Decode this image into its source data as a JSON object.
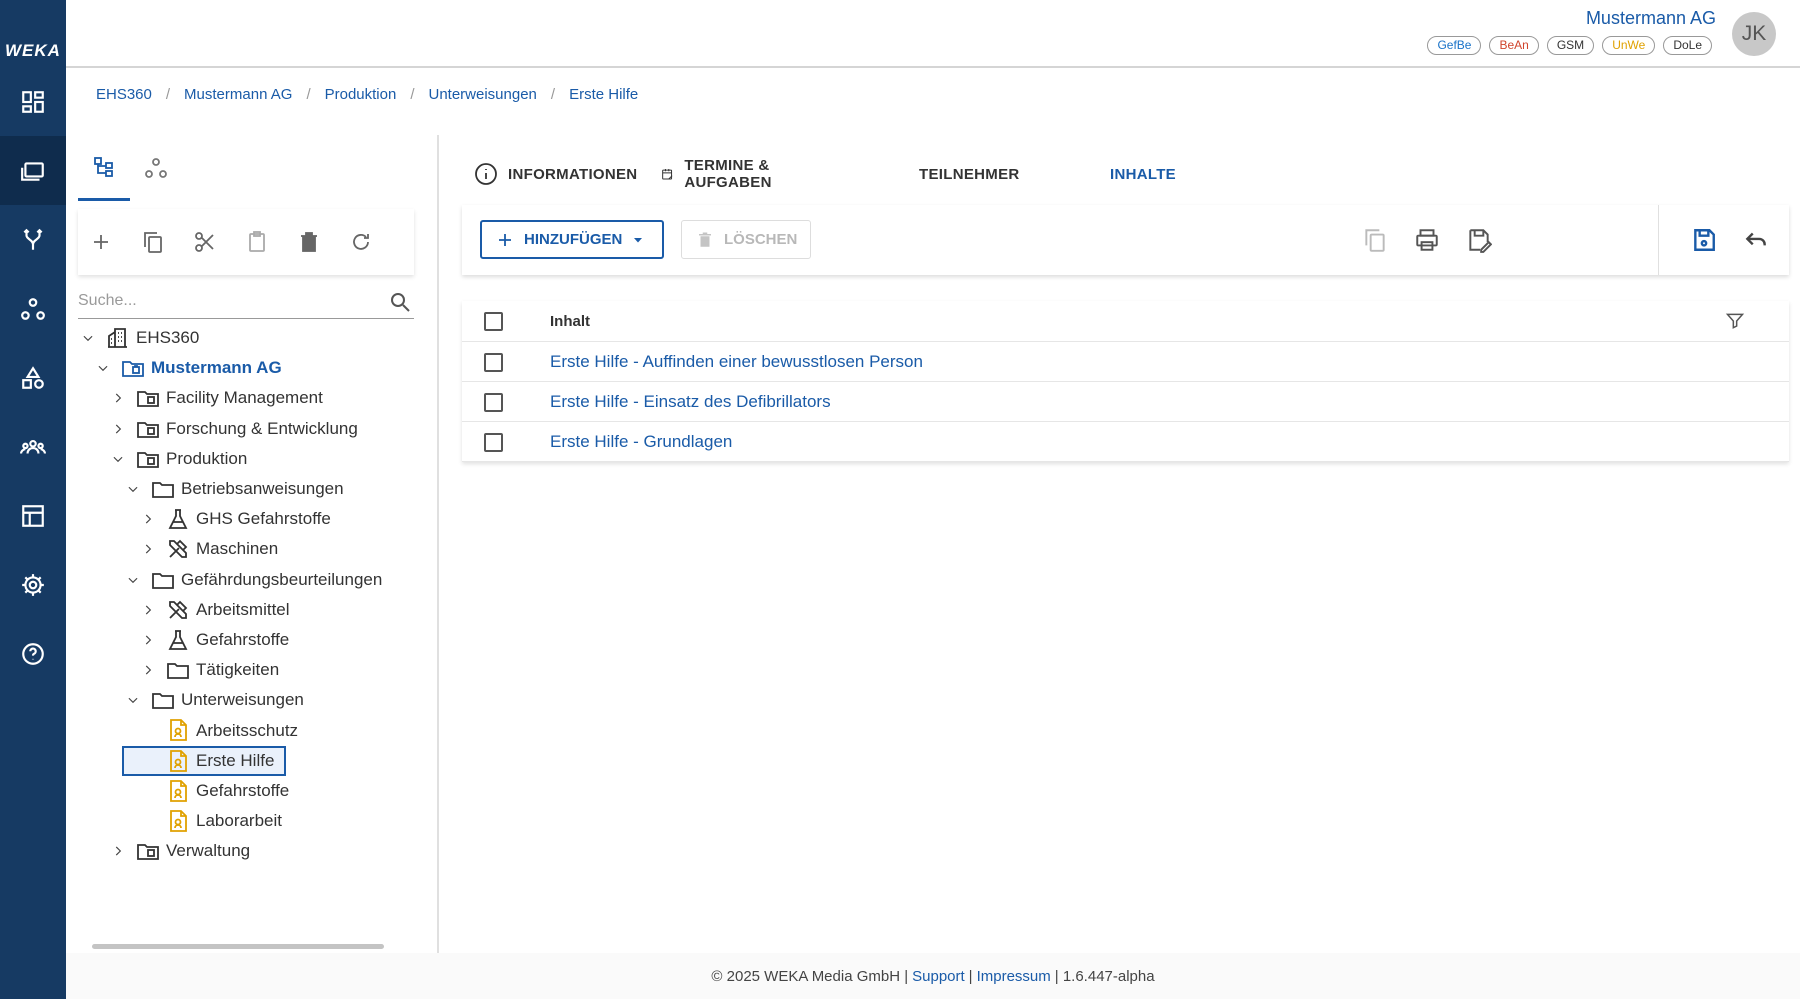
{
  "rail": {
    "logo": "WEKA",
    "items": [
      {
        "name": "dashboard-icon"
      },
      {
        "name": "folders-icon"
      },
      {
        "name": "fork-icon"
      },
      {
        "name": "hierarchy-icon"
      },
      {
        "name": "shapes-icon"
      },
      {
        "name": "team-icon"
      },
      {
        "name": "table-icon"
      },
      {
        "name": "gear-icon"
      },
      {
        "name": "help-icon"
      }
    ]
  },
  "header": {
    "company": "Mustermann AG",
    "badges": [
      {
        "label": "GefBe",
        "color": "#1a73c8"
      },
      {
        "label": "BeAn",
        "color": "#d0442c"
      },
      {
        "label": "GSM",
        "color": "#333333"
      },
      {
        "label": "UnWe",
        "color": "#e0a100"
      },
      {
        "label": "DoLe",
        "color": "#333333"
      }
    ],
    "avatar": "JK"
  },
  "breadcrumb": [
    "EHS360",
    "Mustermann AG",
    "Produktion",
    "Unterweisungen",
    "Erste Hilfe"
  ],
  "tree_panel": {
    "search_placeholder": "Suche...",
    "nodes": [
      {
        "label": "EHS360",
        "level": 0,
        "expanded": true,
        "icon": "building-icon"
      },
      {
        "label": "Mustermann AG",
        "level": 1,
        "expanded": true,
        "icon": "company-folder-icon",
        "bold": true
      },
      {
        "label": "Facility Management",
        "level": 2,
        "expanded": false,
        "icon": "department-folder-icon"
      },
      {
        "label": "Forschung & Entwicklung",
        "level": 2,
        "expanded": false,
        "icon": "department-folder-icon"
      },
      {
        "label": "Produktion",
        "level": 2,
        "expanded": true,
        "icon": "department-folder-icon"
      },
      {
        "label": "Betriebsanweisungen",
        "level": 3,
        "expanded": true,
        "icon": "folder-icon"
      },
      {
        "label": "GHS Gefahrstoffe",
        "level": 4,
        "expanded": false,
        "icon": "flask-icon"
      },
      {
        "label": "Maschinen",
        "level": 4,
        "expanded": false,
        "icon": "tools-icon"
      },
      {
        "label": "Gefährdungsbeurteilungen",
        "level": 3,
        "expanded": true,
        "icon": "folder-icon"
      },
      {
        "label": "Arbeitsmittel",
        "level": 4,
        "expanded": false,
        "icon": "tools-icon"
      },
      {
        "label": "Gefahrstoffe",
        "level": 4,
        "expanded": false,
        "icon": "flask-icon"
      },
      {
        "label": "Tätigkeiten",
        "level": 4,
        "expanded": false,
        "icon": "folder-icon"
      },
      {
        "label": "Unterweisungen",
        "level": 3,
        "expanded": true,
        "icon": "folder-icon"
      },
      {
        "label": "Arbeitsschutz",
        "level": 4,
        "leaf": true,
        "icon": "instruction-doc-icon"
      },
      {
        "label": "Erste Hilfe",
        "level": 4,
        "leaf": true,
        "icon": "instruction-doc-icon",
        "selected": true
      },
      {
        "label": "Gefahrstoffe",
        "level": 4,
        "leaf": true,
        "icon": "instruction-doc-icon"
      },
      {
        "label": "Laborarbeit",
        "level": 4,
        "leaf": true,
        "icon": "instruction-doc-icon"
      },
      {
        "label": "Verwaltung",
        "level": 2,
        "expanded": false,
        "icon": "department-folder-icon"
      }
    ]
  },
  "main_tabs": [
    {
      "label": "INFORMATIONEN",
      "icon": "info-icon"
    },
    {
      "label": "TERMINE & AUFGABEN",
      "icon": "calendar-edit-icon"
    },
    {
      "label": "TEILNEHMER",
      "icon": ""
    },
    {
      "label": "INHALTE",
      "icon": "",
      "active": true
    }
  ],
  "actions": {
    "add_label": "HINZUFÜGEN",
    "delete_label": "LÖSCHEN"
  },
  "table": {
    "header": "Inhalt",
    "rows": [
      "Erste Hilfe - Auffinden einer bewusstlosen Person",
      "Erste Hilfe - Einsatz des Defibrillators",
      "Erste Hilfe - Grundlagen"
    ]
  },
  "footer": {
    "copyright": "© 2025 WEKA Media GmbH |",
    "support": "Support",
    "sep": "|",
    "impressum": "Impressum",
    "version": "| 1.6.447-alpha"
  },
  "colors": {
    "rail": "#163a63",
    "accent": "#1a5ba8",
    "doc_icon": "#e0a100"
  }
}
